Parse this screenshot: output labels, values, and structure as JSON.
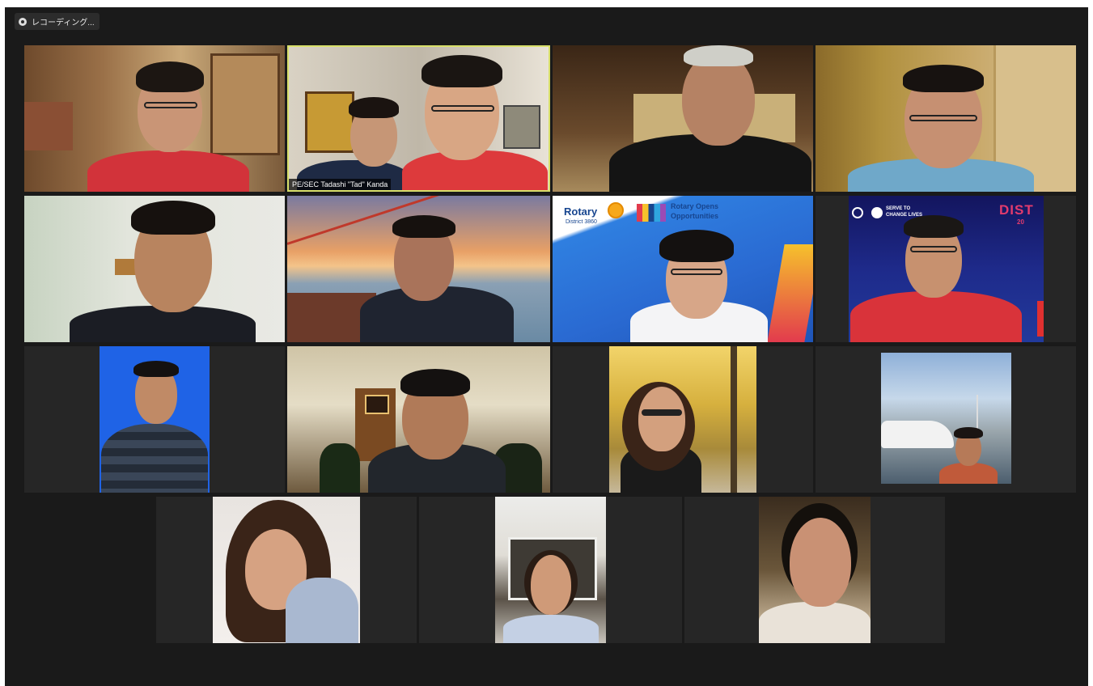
{
  "recording": {
    "label": "レコーディング..."
  },
  "tiles": {
    "t2": {
      "name_label": "PE/SEC Tadashi \"Tad\" Kanda"
    },
    "t7": {
      "banner_brand": "Rotary",
      "banner_district": "District 3860",
      "banner_slogan_1": "Rotary Opens",
      "banner_slogan_2": "Opportunities"
    },
    "t8": {
      "banner_serve_1": "SERVE TO",
      "banner_serve_2": "CHANGE LIVES",
      "banner_dist": "DIST",
      "banner_dist_2": "20"
    }
  },
  "colors": {
    "window_bg": "#1a1a1a",
    "tile_bg": "#262626",
    "active_speaker_border": "#d8df6a"
  }
}
